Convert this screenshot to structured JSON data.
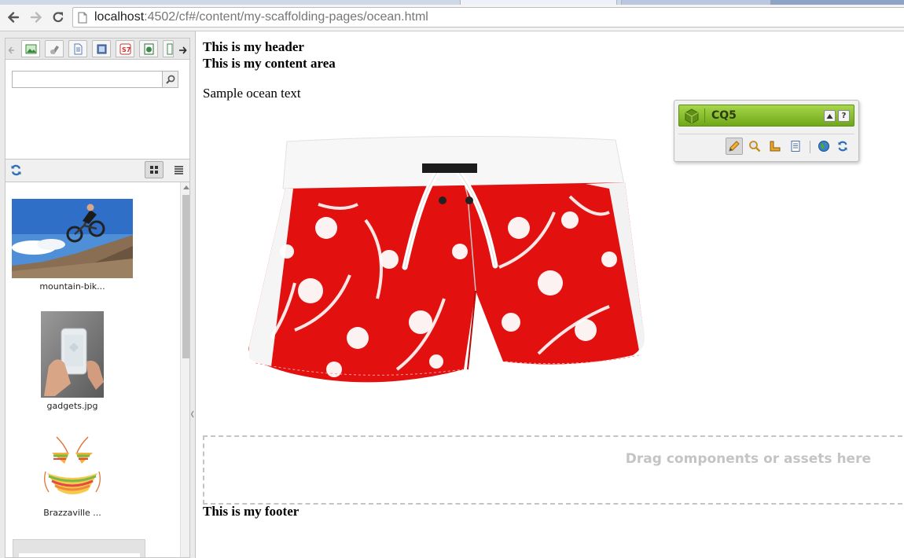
{
  "browser": {
    "url_host": "localhost",
    "url_path": ":4502/cf#/content/my-scaffolding-pages/ocean.html"
  },
  "sidebar": {
    "tabs": [
      "images-tab",
      "components-tab",
      "documents-tab",
      "movies-tab",
      "flash-tab",
      "pages-tab",
      "more-tab"
    ],
    "search_value": "",
    "assets": [
      {
        "caption": "mountain-bik..."
      },
      {
        "caption": "gadgets.jpg"
      },
      {
        "caption": "Brazzaville ..."
      },
      {
        "caption": ""
      }
    ]
  },
  "page": {
    "header": "This is my header",
    "content_area": "This is my content area",
    "text": "Sample ocean text",
    "dropzone_hint": "Drag components or assets here",
    "footer": "This is my footer"
  },
  "sidekick": {
    "title": "CQ5",
    "help_label": "?",
    "brand_color": "#8bc232"
  }
}
